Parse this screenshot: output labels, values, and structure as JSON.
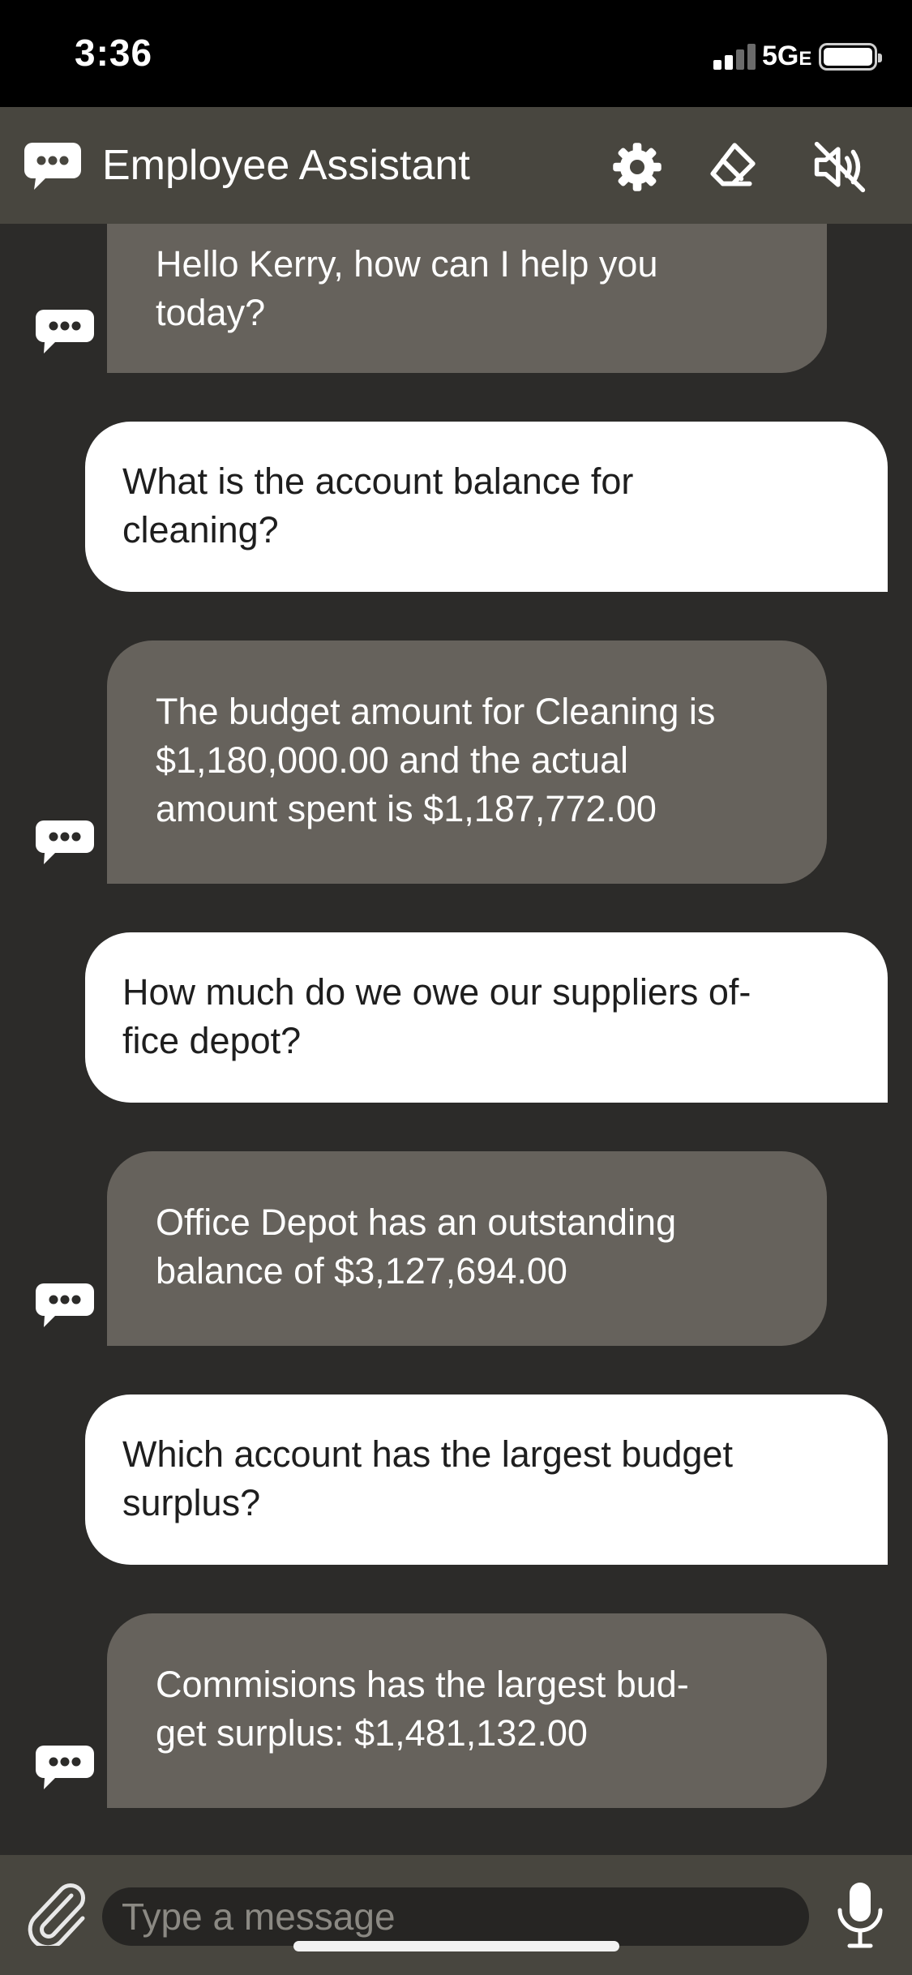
{
  "status_bar": {
    "time": "3:36",
    "network": "5G",
    "network_suffix": "E"
  },
  "header": {
    "title": "Employee Assistant",
    "icons": [
      "chat-bubble-icon",
      "gear-icon",
      "eraser-icon",
      "speaker-muted-icon"
    ]
  },
  "messages": [
    {
      "sender": "bot",
      "text": "Hello Kerry, how can I help you\ntoday?"
    },
    {
      "sender": "user",
      "text": "What is the account balance for\ncleaning?"
    },
    {
      "sender": "bot",
      "text": "The budget amount for Cleaning is\n$1,180,000.00 and the actual\namount spent is $1,187,772.00"
    },
    {
      "sender": "user",
      "text": "How much do we owe our suppliers of-\nfice depot?"
    },
    {
      "sender": "bot",
      "text": "Office Depot has an outstanding\nbalance of $3,127,694.00"
    },
    {
      "sender": "user",
      "text": "Which account has the largest budget\nsurplus?"
    },
    {
      "sender": "bot",
      "text": "Commisions has the largest bud-\nget surplus:  $1,481,132.00"
    }
  ],
  "input": {
    "placeholder": "Type a message",
    "value": ""
  },
  "colors": {
    "status_bar": "#000000",
    "header": "#48463f",
    "background": "#2c2b29",
    "bot_bubble": "#66625c",
    "user_bubble": "#ffffff"
  }
}
